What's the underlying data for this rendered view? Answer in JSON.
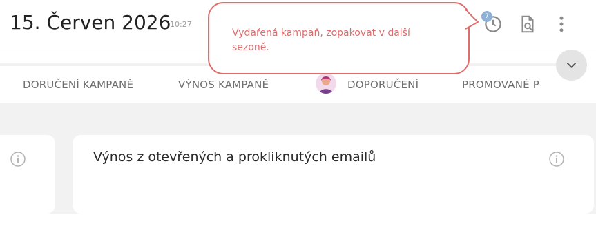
{
  "header": {
    "date": "15. Červen 2026",
    "time": "10:27",
    "notification_count": "7"
  },
  "tooltip": {
    "message": "Vydařená kampaň, zopakovat v další sezoně."
  },
  "tabs": [
    {
      "label": "DORUČENÍ KAMPANĚ"
    },
    {
      "label": "VÝNOS KAMPANĚ"
    },
    {
      "label": "DOPORUČENÍ"
    },
    {
      "label": "PROMOVANÉ P"
    }
  ],
  "card": {
    "title": "Výnos z otevřených a prokliknutých emailů"
  },
  "colors": {
    "accent_red": "#e06c6c",
    "badge_blue": "#8fb0d6",
    "background": "#f2f2f2"
  }
}
